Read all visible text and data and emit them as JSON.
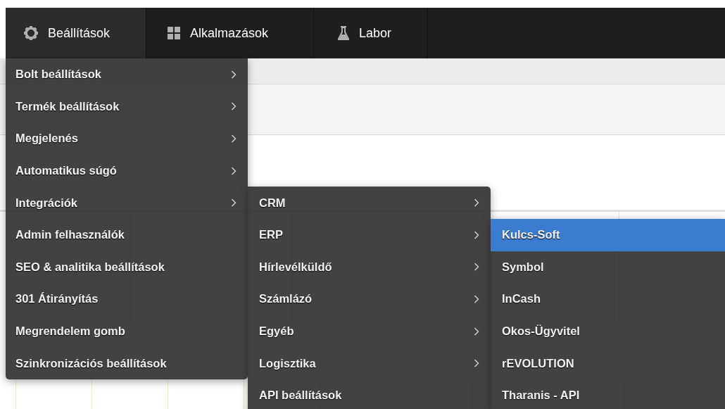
{
  "nav": {
    "tabs": [
      {
        "label": "Beállítások",
        "selected": true
      },
      {
        "label": "Alkalmazások",
        "selected": false
      },
      {
        "label": "Labor",
        "selected": false
      }
    ]
  },
  "menu": {
    "items": [
      {
        "label": "Bolt beállítások",
        "submenu": true
      },
      {
        "label": "Termék beállítások",
        "submenu": true
      },
      {
        "label": "Megjelenés",
        "submenu": true
      },
      {
        "label": "Automatikus súgó",
        "submenu": true
      },
      {
        "label": "Integrációk",
        "submenu": true,
        "children": [
          {
            "label": "CRM",
            "submenu": true
          },
          {
            "label": "ERP",
            "submenu": true,
            "children": [
              {
                "label": "Kulcs-Soft",
                "submenu": false,
                "selected": true
              },
              {
                "label": "Symbol",
                "submenu": false,
                "selected": false
              },
              {
                "label": "InCash",
                "submenu": false,
                "selected": false
              },
              {
                "label": "Okos-Ügyvitel",
                "submenu": false,
                "selected": false
              },
              {
                "label": "rEVOLUTION",
                "submenu": false,
                "selected": false
              },
              {
                "label": "Tharanis - API",
                "submenu": false,
                "selected": false
              }
            ]
          },
          {
            "label": "Hírlevélküldő",
            "submenu": true
          },
          {
            "label": "Számlázó",
            "submenu": true
          },
          {
            "label": "Egyéb",
            "submenu": true
          },
          {
            "label": "Logisztika",
            "submenu": true
          },
          {
            "label": "API beállítások",
            "submenu": false
          }
        ]
      },
      {
        "label": "Admin felhasználók",
        "submenu": false
      },
      {
        "label": "SEO & analitika beállítások",
        "submenu": false
      },
      {
        "label": "301 Átirányítás",
        "submenu": false
      },
      {
        "label": "Megrendelem gomb",
        "submenu": false
      },
      {
        "label": "Szinkronizációs beállítások",
        "submenu": false
      }
    ]
  }
}
